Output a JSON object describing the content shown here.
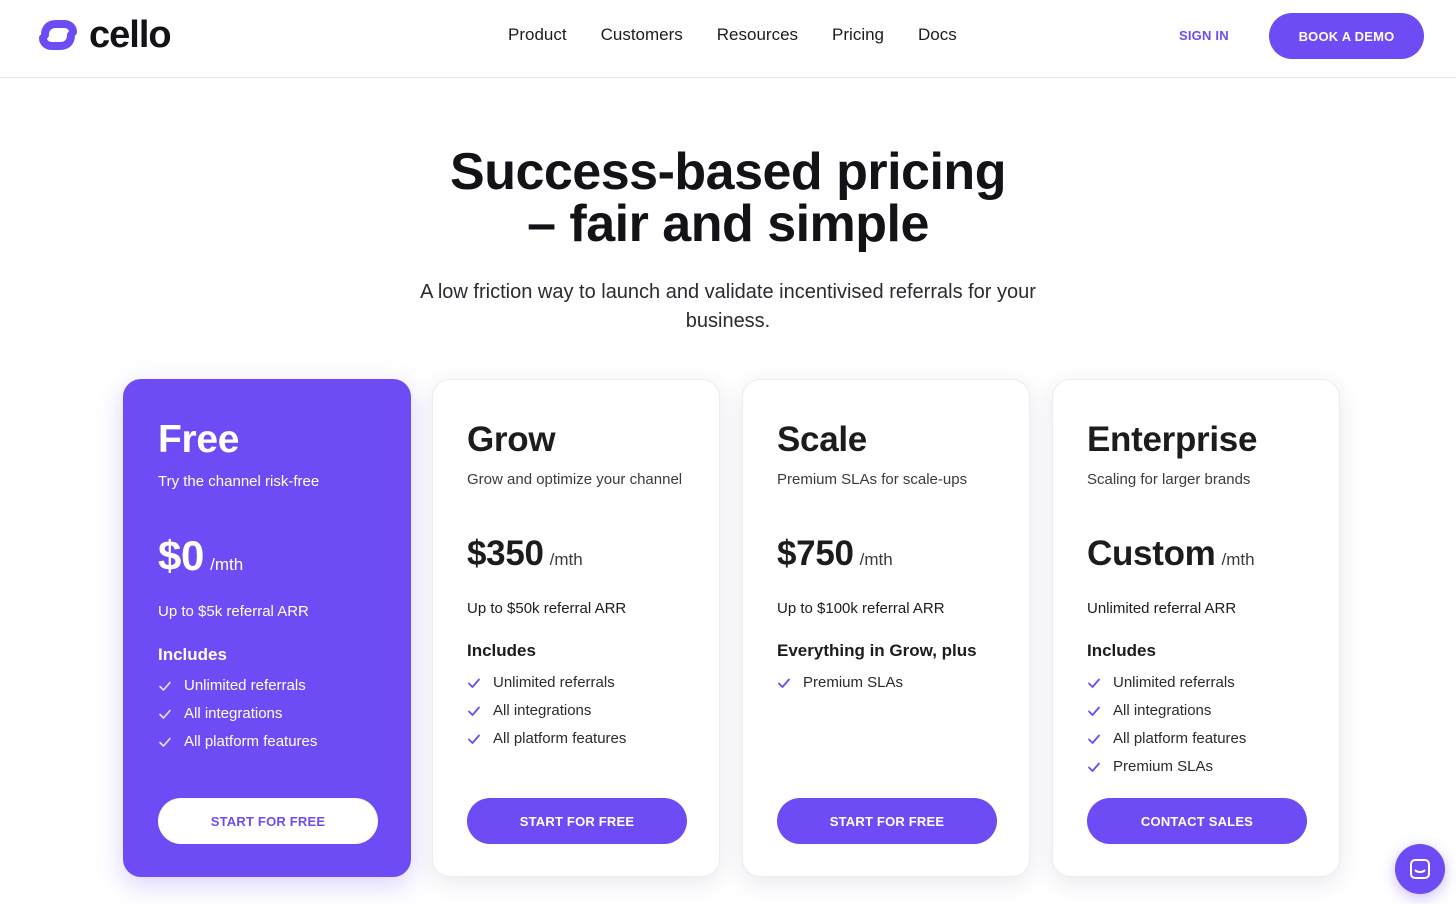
{
  "brand": {
    "name": "cello",
    "accent": "#6d4cf5"
  },
  "nav": {
    "items": [
      "Product",
      "Customers",
      "Resources",
      "Pricing",
      "Docs"
    ]
  },
  "header": {
    "sign_in": "SIGN IN",
    "book_demo": "BOOK A DEMO"
  },
  "hero": {
    "title_line1": "Success-based pricing",
    "title_line2": "– fair and simple",
    "subtitle": "A low friction way to launch and validate incentivised referrals for your business."
  },
  "plans": [
    {
      "name": "Free",
      "description": "Try the channel risk-free",
      "price": "$0",
      "period": "/mth",
      "limit": "Up to $5k referral ARR",
      "includes_title": "Includes",
      "features": [
        "Unlimited referrals",
        "All integrations",
        "All platform features"
      ],
      "cta": "START FOR FREE"
    },
    {
      "name": "Grow",
      "description": "Grow and optimize your channel",
      "price": "$350",
      "period": "/mth",
      "limit": "Up to $50k referral ARR",
      "includes_title": "Includes",
      "features": [
        "Unlimited referrals",
        "All integrations",
        "All platform features"
      ],
      "cta": "START FOR FREE"
    },
    {
      "name": "Scale",
      "description": "Premium SLAs for scale-ups",
      "price": "$750",
      "period": "/mth",
      "limit": "Up to $100k referral ARR",
      "includes_title": "Everything in Grow, plus",
      "features": [
        "Premium SLAs"
      ],
      "cta": "START FOR FREE"
    },
    {
      "name": "Enterprise",
      "description": "Scaling for larger brands",
      "price": "Custom",
      "period": "/mth",
      "limit": "Unlimited referral ARR",
      "includes_title": "Includes",
      "features": [
        "Unlimited referrals",
        "All integrations",
        "All platform features",
        "Premium SLAs"
      ],
      "cta": "CONTACT SALES"
    }
  ],
  "icons": {
    "check": "check-icon",
    "chat": "chat-icon",
    "logo": "cello-logo-icon"
  }
}
